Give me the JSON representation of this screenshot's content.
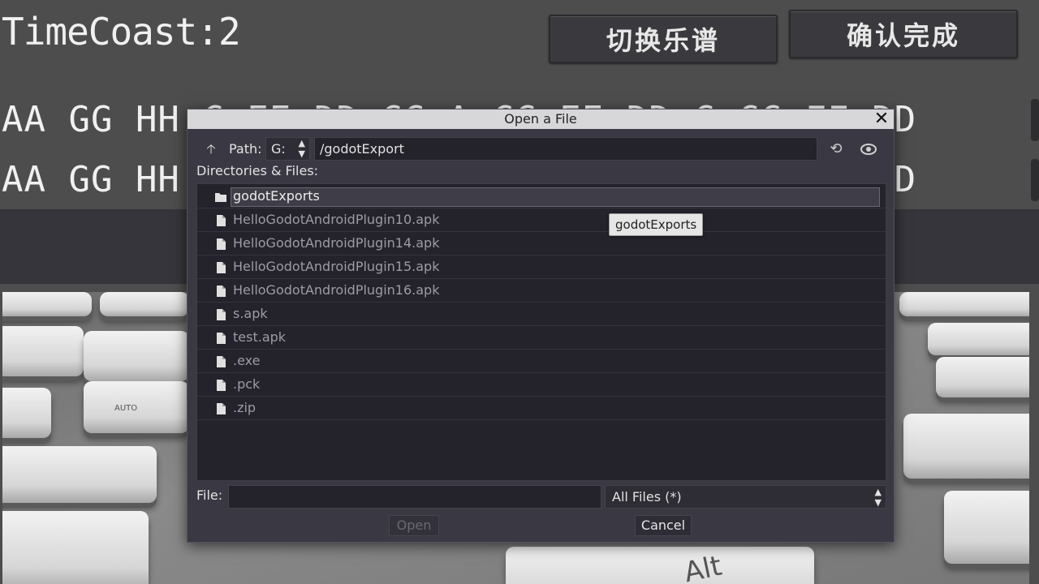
{
  "game": {
    "timecoast": "TimeCoast:2",
    "switch_score_label": "切换乐谱",
    "confirm_label": "确认完成",
    "notes_row1": "AA GG HH C EE DD CC A CC EE DD C CC FF DD",
    "notes_row2": "AA GG HH C EE DD CC A CC EE DD C CC FF DD",
    "key_alt": "Alt",
    "key_auto": "AUTO"
  },
  "dialog": {
    "title": "Open a File",
    "close_symbol": "✕",
    "up_symbol": "🡡",
    "path_label": "Path:",
    "drive": "G:",
    "path_value": "/godotExport",
    "refresh_symbol": "⟲",
    "dirs_label": "Directories & Files:",
    "files": [
      {
        "name": "godotExports",
        "kind": "folder",
        "selected": true
      },
      {
        "name": "HelloGodotAndroidPlugin10.apk",
        "kind": "file"
      },
      {
        "name": "HelloGodotAndroidPlugin14.apk",
        "kind": "file"
      },
      {
        "name": "HelloGodotAndroidPlugin15.apk",
        "kind": "file"
      },
      {
        "name": "HelloGodotAndroidPlugin16.apk",
        "kind": "file"
      },
      {
        "name": "s.apk",
        "kind": "file"
      },
      {
        "name": "test.apk",
        "kind": "file"
      },
      {
        "name": ".exe",
        "kind": "file"
      },
      {
        "name": ".pck",
        "kind": "file"
      },
      {
        "name": ".zip",
        "kind": "file"
      }
    ],
    "tooltip": "godotExports",
    "file_label": "File:",
    "file_value": "",
    "filter": "All Files (*)",
    "open_label": "Open",
    "cancel_label": "Cancel"
  },
  "colors": {
    "dialog_bg": "#3a3842",
    "list_bg": "#24222a",
    "titlebar": "#d7d7da",
    "game_bg": "#4d4d4d"
  }
}
